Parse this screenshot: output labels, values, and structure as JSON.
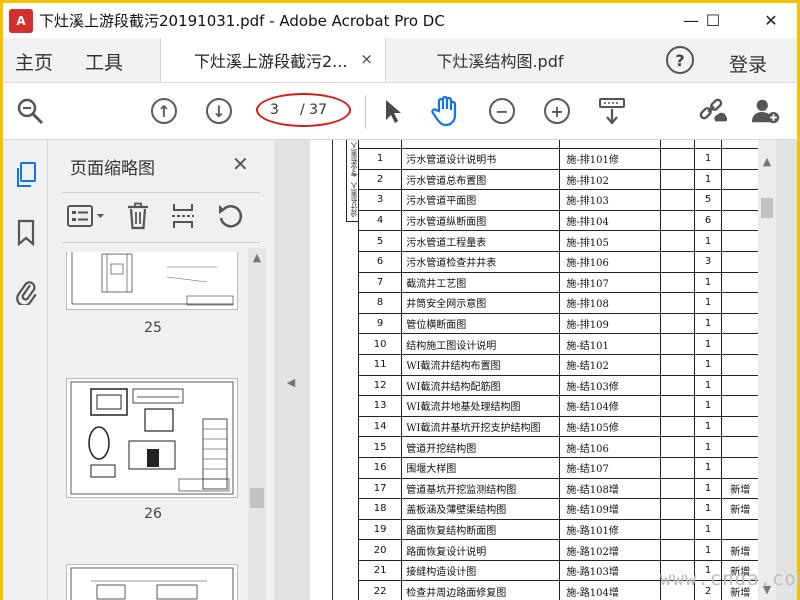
{
  "window": {
    "title": "下灶溪上游段截污20191031.pdf - Adobe Acrobat Pro DC",
    "logo_text": "A",
    "minimize": "—",
    "maximize": "☐",
    "close": "✕"
  },
  "menu": {
    "home": "主页",
    "tools": "工具",
    "help": "?",
    "login": "登录"
  },
  "tabs": [
    {
      "label": "下灶溪上游段截污2...",
      "close": "×"
    },
    {
      "label": "下灶溪结构图.pdf"
    }
  ],
  "toolbar": {
    "page_current": "3",
    "page_total": "/ 37",
    "icons": [
      "zoom-search-icon",
      "page-up-icon",
      "page-down-icon",
      "select-arrow-icon",
      "hand-tool-icon",
      "zoom-out-icon",
      "zoom-in-icon",
      "scroll-mode-icon",
      "share-link-icon",
      "add-user-icon"
    ]
  },
  "sidebar": {
    "panel_title": "页面缩略图",
    "close": "✕",
    "thumbnails": [
      {
        "page": "25"
      },
      {
        "page": "26"
      }
    ]
  },
  "document": {
    "side_labels": [
      "设计负责人",
      "专业负责人"
    ],
    "rows": [
      {
        "no": "1",
        "name": "污水管道设计说明书",
        "code": "施-排101修",
        "count": "1",
        "note": ""
      },
      {
        "no": "2",
        "name": "污水管道总布置图",
        "code": "施-排102",
        "count": "1",
        "note": ""
      },
      {
        "no": "3",
        "name": "污水管道平面图",
        "code": "施-排103",
        "count": "5",
        "note": ""
      },
      {
        "no": "4",
        "name": "污水管道纵断面图",
        "code": "施-排104",
        "count": "6",
        "note": ""
      },
      {
        "no": "5",
        "name": "污水管道工程量表",
        "code": "施-排105",
        "count": "1",
        "note": ""
      },
      {
        "no": "6",
        "name": "污水管道检查井井表",
        "code": "施-排106",
        "count": "3",
        "note": ""
      },
      {
        "no": "7",
        "name": "截流井工艺图",
        "code": "施-排107",
        "count": "1",
        "note": ""
      },
      {
        "no": "8",
        "name": "井筒安全网示意图",
        "code": "施-排108",
        "count": "1",
        "note": ""
      },
      {
        "no": "9",
        "name": "管位横断面图",
        "code": "施-排109",
        "count": "1",
        "note": ""
      },
      {
        "no": "10",
        "name": "结构施工图设计说明",
        "code": "施-结101",
        "count": "1",
        "note": ""
      },
      {
        "no": "11",
        "name": "WI截流井结构布置图",
        "code": "施-结102",
        "count": "1",
        "note": ""
      },
      {
        "no": "12",
        "name": "WI截流井结构配筋图",
        "code": "施-结103修",
        "count": "1",
        "note": ""
      },
      {
        "no": "13",
        "name": "WI截流井地基处理结构图",
        "code": "施-结104修",
        "count": "1",
        "note": ""
      },
      {
        "no": "14",
        "name": "WI截流井基坑开挖支护结构图",
        "code": "施-结105修",
        "count": "1",
        "note": ""
      },
      {
        "no": "15",
        "name": "管道开挖结构图",
        "code": "施-结106",
        "count": "1",
        "note": ""
      },
      {
        "no": "16",
        "name": "围堰大样图",
        "code": "施-结107",
        "count": "1",
        "note": ""
      },
      {
        "no": "17",
        "name": "管道基坑开挖监测结构图",
        "code": "施-结108增",
        "count": "1",
        "note": "新增"
      },
      {
        "no": "18",
        "name": "盖板涵及薄壁渠结构图",
        "code": "施-结109增",
        "count": "1",
        "note": "新增"
      },
      {
        "no": "19",
        "name": "路面恢复结构断面图",
        "code": "施-路101修",
        "count": "1",
        "note": ""
      },
      {
        "no": "20",
        "name": "路面恢复设计说明",
        "code": "施-路102增",
        "count": "1",
        "note": "新增"
      },
      {
        "no": "21",
        "name": "接缝构造设计图",
        "code": "施-路103增",
        "count": "1",
        "note": "新增"
      },
      {
        "no": "22",
        "name": "检查井周边路面修复图",
        "code": "施-路104增",
        "count": "2",
        "note": "新增"
      }
    ]
  },
  "watermark": "www.cnda.com"
}
